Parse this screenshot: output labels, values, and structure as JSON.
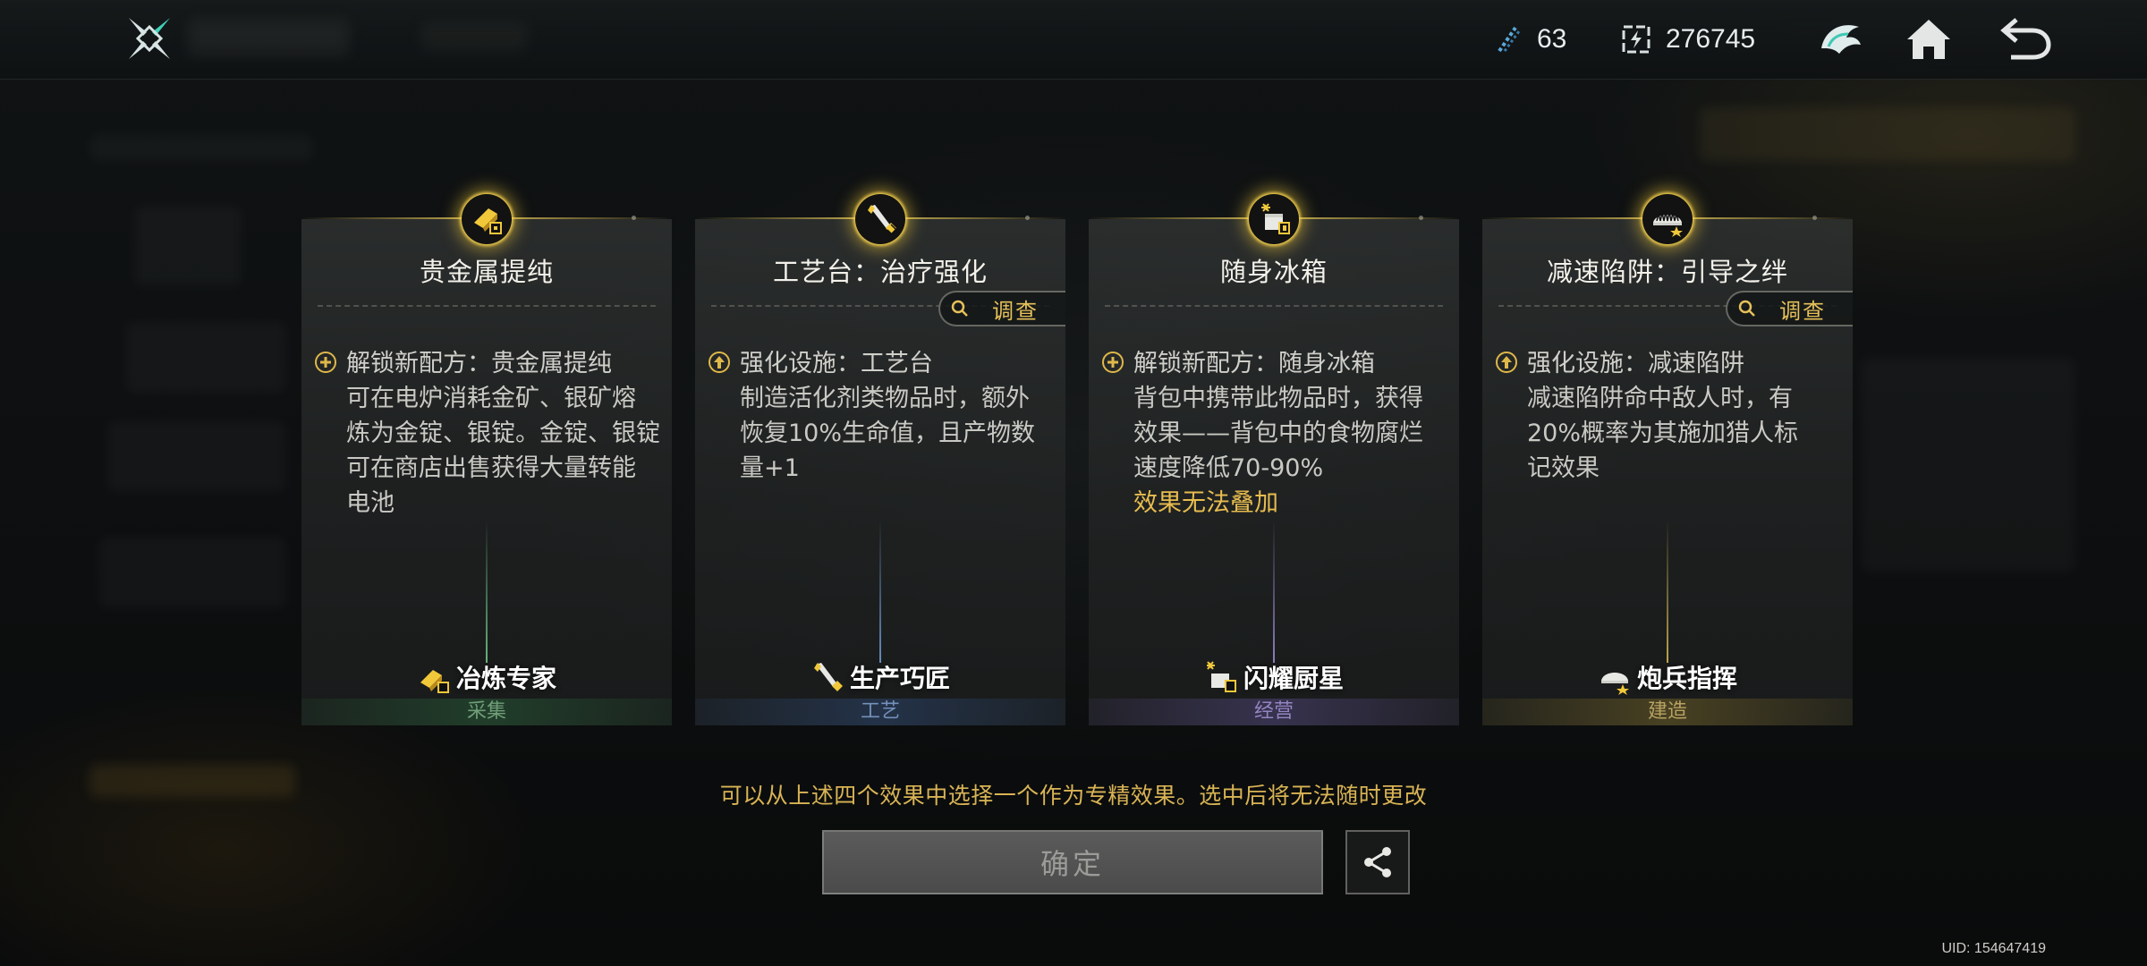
{
  "topbar": {
    "resources": [
      {
        "icon": "energy-crystal-icon",
        "value": "63"
      },
      {
        "icon": "battery-charge-icon",
        "value": "276745"
      }
    ],
    "buttons": [
      {
        "icon": "helmet-emblem-icon"
      },
      {
        "icon": "home-icon"
      },
      {
        "icon": "back-arrow-icon"
      }
    ]
  },
  "cards": [
    {
      "title": "贵金属提纯",
      "badge_icon": "gold-ingot-icon",
      "effect_type_icon": "plus-circle-icon",
      "effect_lines": [
        "解锁新配方：贵金属提纯",
        "可在电炉消耗金矿、银矿熔",
        "炼为金锭、银锭。金锭、银锭",
        "可在商店出售获得大量转能",
        "电池"
      ],
      "warning": "",
      "investigate": "",
      "spec_name": "冶炼专家",
      "category": "采集",
      "category_color": "#5f8f6a"
    },
    {
      "title": "工艺台：治疗强化",
      "badge_icon": "wrench-tool-icon",
      "effect_type_icon": "arrow-up-circle-icon",
      "effect_lines": [
        "强化设施：工艺台",
        "制造活化剂类物品时，额外",
        "恢复10%生命值，且产物数",
        "量+1"
      ],
      "warning": "",
      "investigate": "调查",
      "spec_name": "生产巧匠",
      "category": "工艺",
      "category_color": "#6a86b0"
    },
    {
      "title": "随身冰箱",
      "badge_icon": "cooler-box-icon",
      "effect_type_icon": "plus-circle-icon",
      "effect_lines": [
        "解锁新配方：随身冰箱",
        "背包中携带此物品时，获得",
        "效果——背包中的食物腐烂",
        "速度降低70-90%"
      ],
      "warning": "效果无法叠加",
      "investigate": "",
      "spec_name": "闪耀厨星",
      "category": "经营",
      "category_color": "#8e80b8"
    },
    {
      "title": "减速陷阱：引导之绊",
      "badge_icon": "trap-icon",
      "effect_type_icon": "arrow-up-circle-icon",
      "effect_lines": [
        "强化设施：减速陷阱",
        "减速陷阱命中敌人时，有",
        "20%概率为其施加猎人标",
        "记效果"
      ],
      "warning": "",
      "investigate": "调查",
      "spec_name": "炮兵指挥",
      "category": "建造",
      "category_color": "#b09a55"
    }
  ],
  "hint": "可以从上述四个效果中选择一个作为专精效果。选中后将无法随时更改",
  "confirm_label": "确定",
  "share_icon": "share-icon",
  "uid": "UID: 154647419"
}
